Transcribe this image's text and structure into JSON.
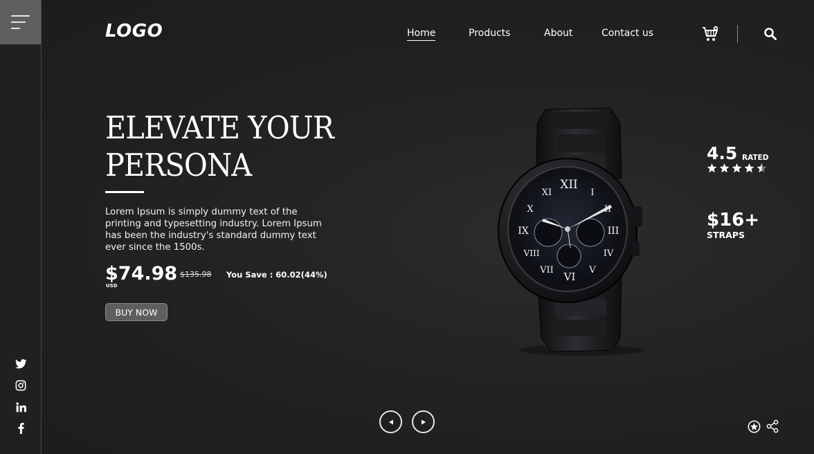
{
  "brand": {
    "logo": "LOGO"
  },
  "nav": {
    "items": [
      {
        "label": "Home",
        "active": true
      },
      {
        "label": "Products",
        "active": false
      },
      {
        "label": "About",
        "active": false
      },
      {
        "label": "Contact us",
        "active": false
      }
    ]
  },
  "header_icons": [
    "cart-icon",
    "search-icon"
  ],
  "hero": {
    "title_line1": "ELEVATE YOUR",
    "title_line2": "PERSONA",
    "description": "Lorem Ipsum is simply dummy text of the printing and typesetting industry. Lorem Ipsum has been the industry's standard dummy text ever since the 1500s.",
    "price": "$74.98",
    "currency": "USD",
    "old_price": "$135.98",
    "you_save": "You Save : 60.02(44%)",
    "buy_button": "BUY NOW"
  },
  "stats": {
    "rating_value": "4.5",
    "rating_label": "RATED",
    "rating_stars": 4.5,
    "straps_value": "$16+",
    "straps_label": "STRAPS"
  },
  "social_icons": [
    "twitter-icon",
    "instagram-icon",
    "linkedin-icon",
    "facebook-icon"
  ],
  "footer_icons": [
    "favorite-star-icon",
    "share-icon"
  ],
  "colors": {
    "background": "#222222",
    "sidebar_menu": "#5f5f5f",
    "button": "#5e5e5e",
    "text": "#ffffff"
  }
}
